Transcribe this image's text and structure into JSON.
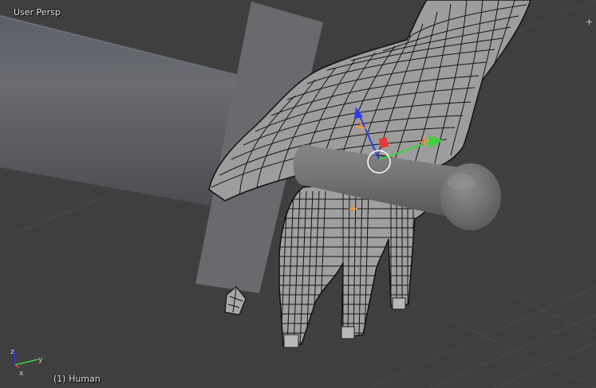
{
  "viewport": {
    "view_name": "User Persp",
    "object_label": "(1) Human",
    "props_toggle_glyph": "+"
  },
  "axis_gizmo": {
    "x": "x",
    "y": "y",
    "z": "z"
  },
  "colors": {
    "background": "#3f3f3f",
    "grid": "#4a4a4a",
    "mesh_fill": "#9a9a9a",
    "wireframe": "#111111",
    "axis_x": "#e23c3c",
    "axis_y": "#3fd13f",
    "axis_z": "#2a3cf0"
  }
}
